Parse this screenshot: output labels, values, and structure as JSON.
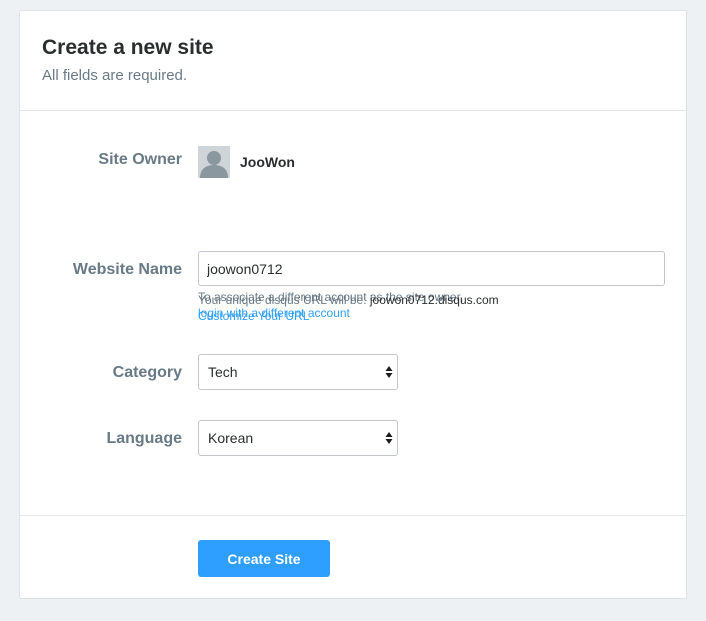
{
  "header": {
    "title": "Create a new site",
    "subtitle": "All fields are required."
  },
  "owner": {
    "label": "Site Owner",
    "name": "JooWon",
    "help": "To associate a different account as the site owner,",
    "link": "login with a different account"
  },
  "website": {
    "label": "Website Name",
    "value": "joowon0712",
    "help_prefix": "Your unique disqus URL will be:",
    "url": "joowon0712.disqus.com",
    "link": "Customize Your URL"
  },
  "category": {
    "label": "Category",
    "selected": "Tech"
  },
  "language": {
    "label": "Language",
    "selected": "Korean"
  },
  "actions": {
    "submit_label": "Create Site"
  },
  "colors": {
    "accent": "#2e9fff",
    "label": "#687a86",
    "text": "#2a2e2e",
    "background": "#eef1f4"
  }
}
